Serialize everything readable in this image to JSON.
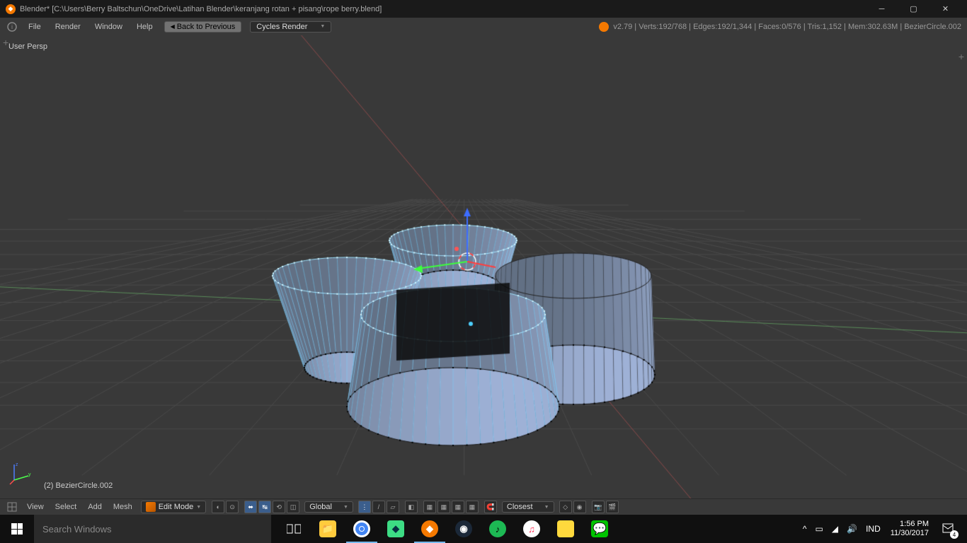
{
  "titlebar": {
    "title": "Blender* [C:\\Users\\Berry Baltschun\\OneDrive\\Latihan Blender\\keranjang rotan + pisang\\rope berry.blend]"
  },
  "topmenu": {
    "file": "File",
    "render": "Render",
    "window": "Window",
    "help": "Help",
    "back": "Back to Previous",
    "engine": "Cycles Render",
    "stats": "v2.79 | Verts:192/768 | Edges:192/1,344 | Faces:0/576 | Tris:1,152 | Mem:302.63M | BezierCircle.002"
  },
  "viewport": {
    "persp": "User Persp",
    "object": "(2) BezierCircle.002"
  },
  "bottombar": {
    "view": "View",
    "select": "Select",
    "add": "Add",
    "mesh": "Mesh",
    "mode": "Edit Mode",
    "orient": "Global",
    "snap": "Closest"
  },
  "taskbar": {
    "search": "Search Windows",
    "lang": "IND",
    "time": "1:56 PM",
    "date": "11/30/2017",
    "notif_count": "4"
  }
}
